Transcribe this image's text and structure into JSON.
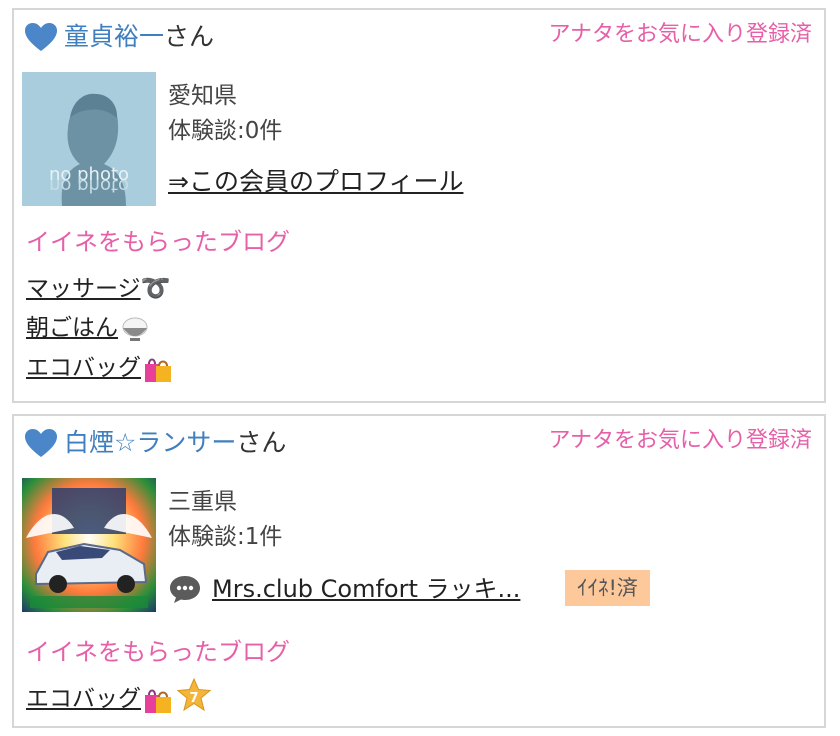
{
  "members": [
    {
      "name": "童貞裕一",
      "honorific": "さん",
      "favorite_status": "アナタをお気に入り登録済",
      "prefecture": "愛知県",
      "experience_count": "体験談:0件",
      "avatar_text": "no photo",
      "profile_link": "⇒この会員のプロフィール",
      "liked_blogs_title": "イイネをもらったブログ",
      "liked_blogs": [
        {
          "title": "マッサージ",
          "emoji": "➰"
        },
        {
          "title": "朝ごはん",
          "emoji": "rice-bowl"
        },
        {
          "title": "エコバッグ",
          "emoji": "shopping-bags"
        }
      ]
    },
    {
      "name": "白煙☆ランサー",
      "honorific": "さん",
      "favorite_status": "アナタをお気に入り登録済",
      "prefecture": "三重県",
      "experience_count": "体験談:1件",
      "review_title": "Mrs.club Comfort ラッキ...",
      "review_badge": "ｲｲﾈ!済",
      "liked_blogs_title": "イイネをもらったブログ",
      "liked_blogs": [
        {
          "title": "エコバッグ",
          "emoji": "shopping-bags",
          "star_badge": "7"
        }
      ]
    }
  ],
  "colors": {
    "name": "#3f7fbf",
    "pink": "#e65fa8",
    "heart": "#4a86c8",
    "badge_bg": "#fdc99b",
    "border": "#d6d6d6"
  }
}
